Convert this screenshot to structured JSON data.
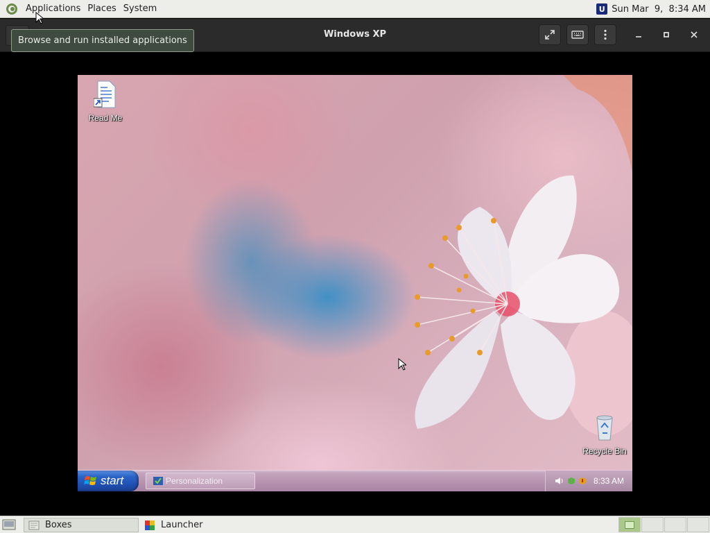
{
  "top_panel": {
    "menus": [
      "Applications",
      "Places",
      "System"
    ],
    "clock": "Sun Mar  9,  8:34 AM",
    "tray_icon": "updates-icon"
  },
  "window": {
    "title": "Windows XP",
    "tooltip": "Browse and run installed applications",
    "buttons": [
      "fullscreen-icon",
      "keyboard-icon",
      "menu-icon",
      "minimize-icon",
      "maximize-icon",
      "close-icon"
    ]
  },
  "vm": {
    "desktop_icons": {
      "read_me": "Read Me",
      "recycle_bin": "Recycle Bin"
    },
    "taskbar": {
      "start_label": "start",
      "task_label": "Personalization",
      "tray_time": "8:33 AM"
    }
  },
  "bottom_panel": {
    "items": [
      "Boxes",
      "Launcher"
    ]
  },
  "colors": {
    "panel": "#edeeea",
    "header": "#2b2b2b",
    "start_button": "#2a63c8",
    "taskbar": "#b995b2"
  }
}
